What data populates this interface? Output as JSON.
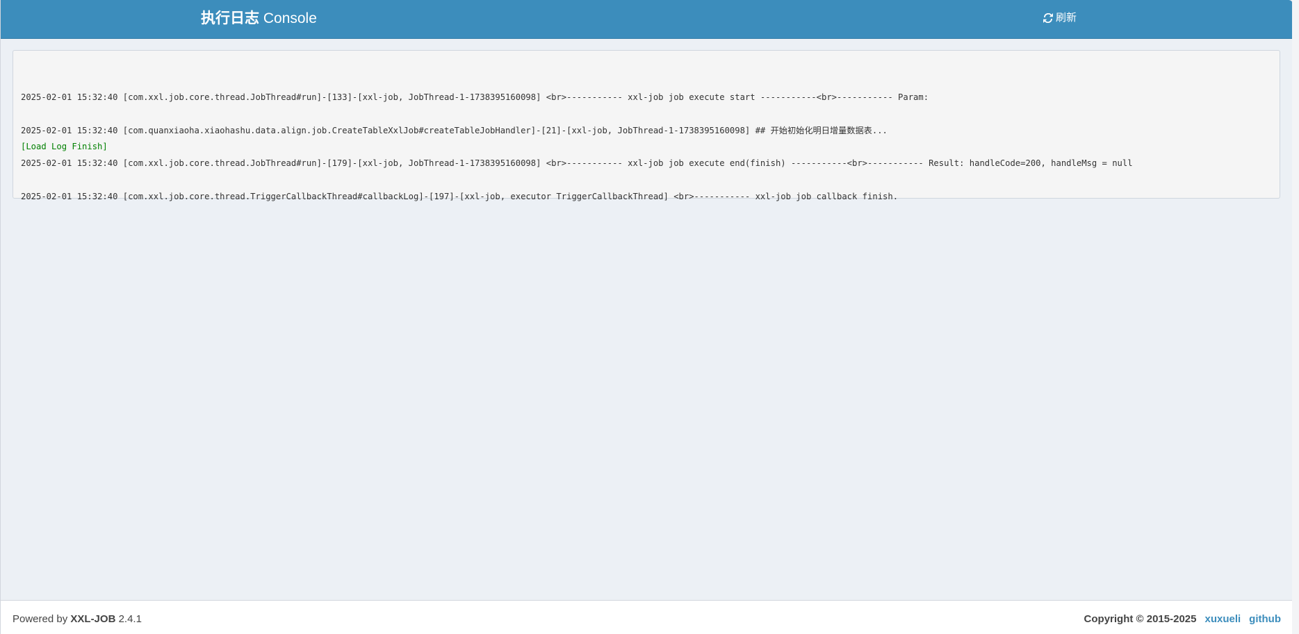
{
  "header": {
    "title_strong": "执行日志",
    "title_rest": "Console",
    "refresh_label": "刷新",
    "refresh_icon": "refresh-icon"
  },
  "log": {
    "lines": [
      "2025-02-01 15:32:40 [com.xxl.job.core.thread.JobThread#run]-[133]-[xxl-job, JobThread-1-1738395160098] <br>----------- xxl-job job execute start -----------<br>----------- Param:",
      "2025-02-01 15:32:40 [com.quanxiaoha.xiaohashu.data.align.job.CreateTableXxlJob#createTableJobHandler]-[21]-[xxl-job, JobThread-1-1738395160098] ## 开始初始化明日增量数据表...",
      "2025-02-01 15:32:40 [com.xxl.job.core.thread.JobThread#run]-[179]-[xxl-job, JobThread-1-1738395160098] <br>----------- xxl-job job execute end(finish) -----------<br>----------- Result: handleCode=200, handleMsg = null",
      "2025-02-01 15:32:40 [com.xxl.job.core.thread.TriggerCallbackThread#callbackLog]-[197]-[xxl-job, executor TriggerCallbackThread] <br>----------- xxl-job job callback finish."
    ],
    "finish_text": "[Load Log Finish]"
  },
  "footer": {
    "powered_prefix": "Powered by",
    "brand": "XXL-JOB",
    "version": "2.4.1",
    "copyright": "Copyright © 2015-2025",
    "author_link": "xuxueli",
    "github_link": "github"
  },
  "colors": {
    "header_bg": "#3c8dbc",
    "page_bg": "#ecf0f5",
    "log_bg": "#f5f5f5",
    "finish_text": "#008000",
    "link": "#3c8dbc"
  }
}
